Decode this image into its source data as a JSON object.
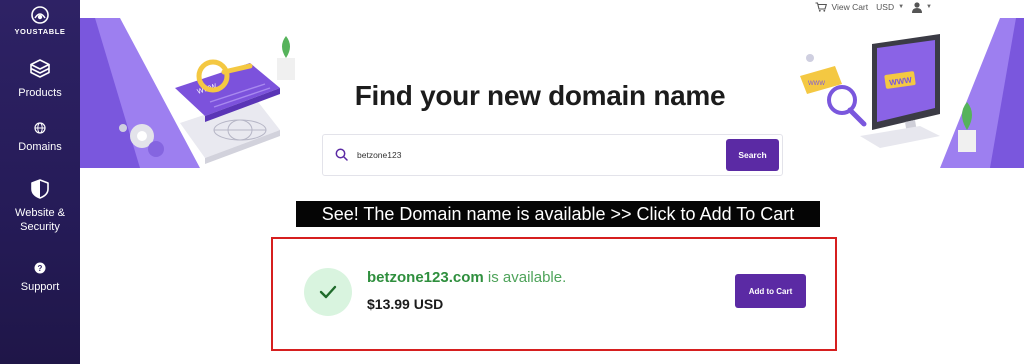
{
  "brand": {
    "logo_text": "YOUSTABLE"
  },
  "sidebar": {
    "items": [
      {
        "label": "Products",
        "icon": "stack-icon"
      },
      {
        "label": "Domains",
        "icon": "globe-icon"
      },
      {
        "label": "Website & Security",
        "icon": "shield-icon"
      },
      {
        "label": "Support",
        "icon": "help-icon"
      }
    ]
  },
  "topbar": {
    "view_cart": "View Cart",
    "currency": "USD"
  },
  "hero": {
    "title": "Find your new domain name"
  },
  "search": {
    "value": "betzone123",
    "button_label": "Search"
  },
  "banner": {
    "text": "See! The Domain name is available >> Click to Add To Cart"
  },
  "result": {
    "domain": "betzone123.com",
    "status": " is available.",
    "price": "$13.99 USD",
    "button_label": "Add to Cart"
  },
  "colors": {
    "accent": "#5b2aa4",
    "sidebar": "#2e2265",
    "success": "#2f8f3e",
    "highlight_border": "#d61f1f"
  }
}
